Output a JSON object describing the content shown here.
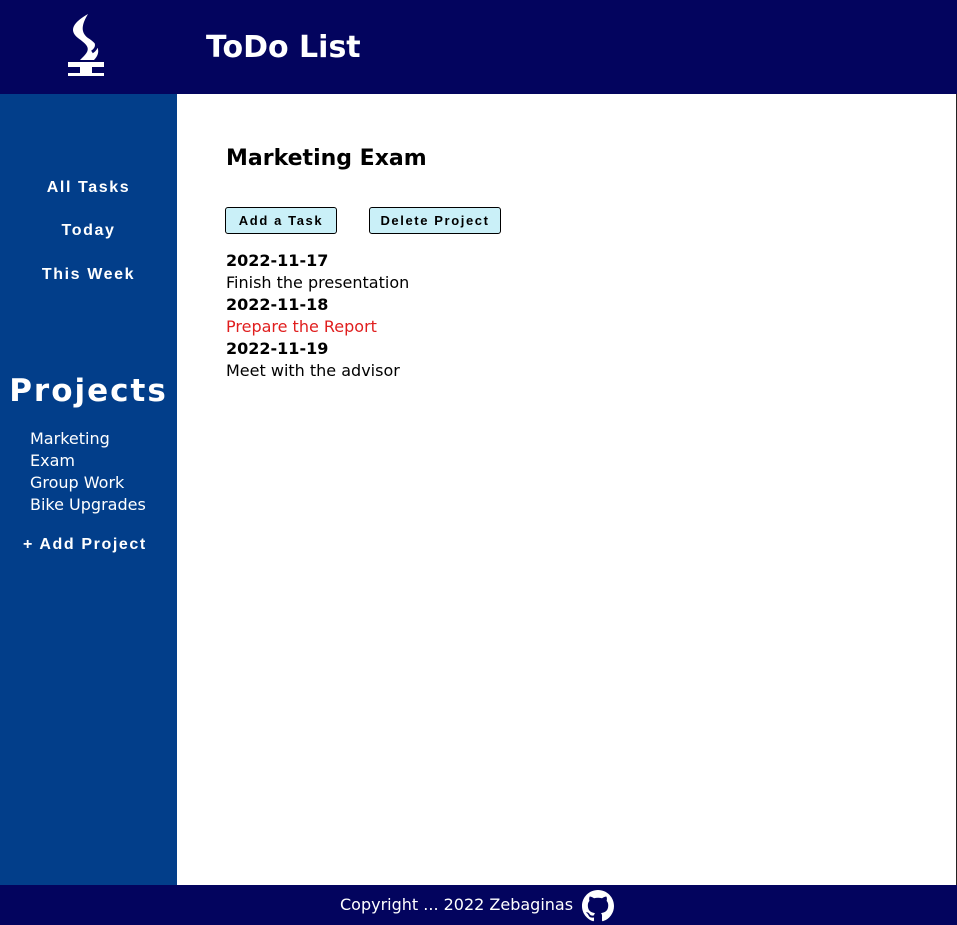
{
  "header": {
    "title": "ToDo List",
    "logo_icon": "torch-logo-icon"
  },
  "sidebar": {
    "nav": [
      {
        "label": "All Tasks"
      },
      {
        "label": "Today"
      },
      {
        "label": "This Week"
      }
    ],
    "projects_heading": "Projects",
    "projects": [
      {
        "label": "Marketing"
      },
      {
        "label": "Exam"
      },
      {
        "label": "Group Work"
      },
      {
        "label": "Bike Upgrades"
      }
    ],
    "add_project_label": "+ Add Project"
  },
  "main": {
    "project_title": "Marketing Exam",
    "add_task_label": "Add a Task",
    "delete_project_label": "Delete Project",
    "tasks": [
      {
        "date": "2022-11-17",
        "title": "Finish the presentation",
        "color": "#000000"
      },
      {
        "date": "2022-11-18",
        "title": "Prepare the Report",
        "color": "#e01e1e"
      },
      {
        "date": "2022-11-19",
        "title": "Meet with the advisor",
        "color": "#000000"
      }
    ]
  },
  "footer": {
    "copyright": "Copyright ... 2022 Zebaginas",
    "github_icon": "github-icon"
  },
  "colors": {
    "header_bg": "#03045e",
    "sidebar_bg": "#023e8a",
    "button_bg": "#caf0f8",
    "overdue_task": "#e01e1e"
  }
}
